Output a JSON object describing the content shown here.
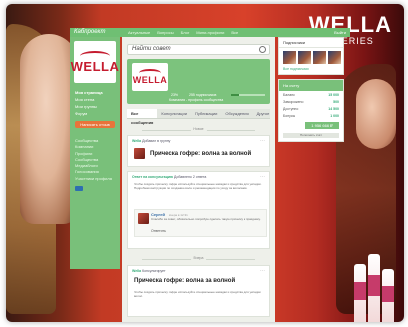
{
  "background_brand": {
    "name": "WELLA",
    "sub": "PRO SERIES"
  },
  "topbar": {
    "logo": "Кабпроект",
    "nav": [
      "Актуальные",
      "Вопросы",
      "Блог",
      "Мини-профили",
      "Все"
    ],
    "exit": "Выйти"
  },
  "sidebar": {
    "brand": "WELLA",
    "menu": [
      "Моя страница",
      "Моя стена",
      "Мои группы",
      "Форум"
    ],
    "cta": "Написать отзыв",
    "links": [
      "Сообщества",
      "Компании",
      "Профили",
      "Сообщества",
      "Медиаблоги",
      "Голосования",
      "Участники профиля"
    ]
  },
  "search": {
    "placeholder": "Найти совет"
  },
  "brand_card": {
    "brand": "WELLA",
    "stat1": "23%",
    "stat2": "255 подписчиков",
    "progress": 0.23,
    "info": "Компания - профиль сообщества"
  },
  "tabs": [
    "Все сообщения",
    "Консультации",
    "Публикации",
    "Обсуждения",
    "Другое"
  ],
  "dividers": {
    "first": "Новое",
    "second": "Вчера"
  },
  "posts": [
    {
      "meta_author": "Wella",
      "meta_text": "Добавил в группу",
      "title": "Прическа гофре: волна за волной"
    },
    {
      "meta_author": "Ответ на консультацию",
      "meta_text": "Добавлено 2 ответа",
      "body": "Чтобы создать прическу гофре используйте специальные насадки и средства для укладки. Подробная инструкция по созданию волн и рекомендации по уходу за волосами.",
      "comment": {
        "name": "Сергей",
        "time": "вчера в 12:31",
        "text": "Спасибо за совет, обязательно попробую сделать такую прическу к празднику.",
        "reply": "Ответить"
      }
    },
    {
      "meta_author": "Wella",
      "meta_text": "Консультирует",
      "title": "Прическа гофре: волна за волной",
      "body": "Чтобы создать прическу гофре используйте специальные насадки и средства для укладки волос."
    }
  ],
  "right": {
    "subscribers_title": "Подписчики",
    "subscribers_link": "Все подписчики",
    "account_title": "На счету",
    "account_rows": [
      {
        "label": "Баланс",
        "value": "15 000"
      },
      {
        "label": "Заморожено",
        "value": "500"
      },
      {
        "label": "Доступно",
        "value": "14 500"
      },
      {
        "label": "Бонусы",
        "value": "1 000"
      }
    ],
    "account_total": "1 956 666 ₽",
    "account_button": "Пополнить счёт"
  },
  "colors": {
    "accent": "#79c07a",
    "brand": "#c51c2f",
    "cta": "#e8733a"
  }
}
